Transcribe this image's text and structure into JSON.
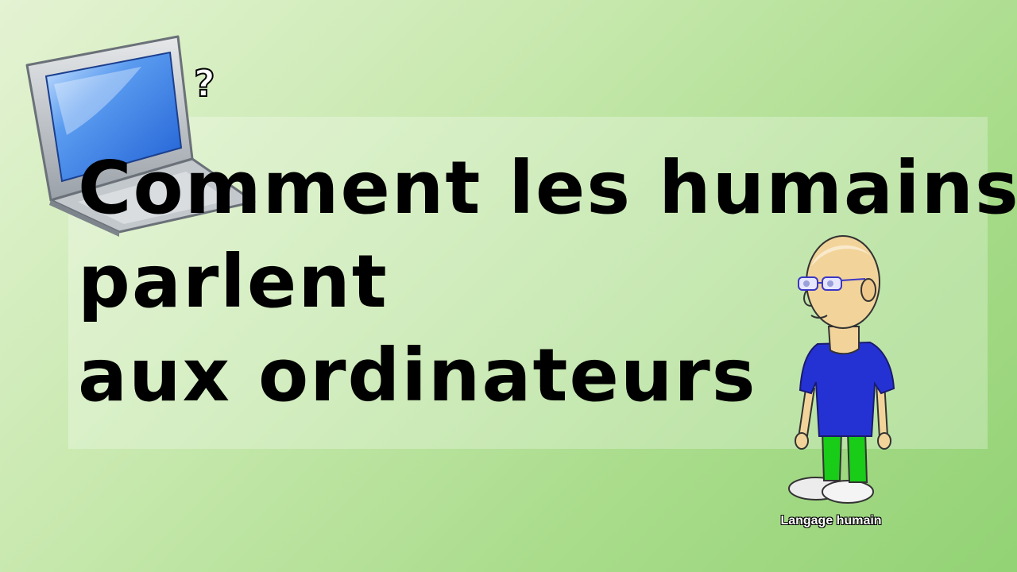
{
  "slide": {
    "title_lines": [
      "Comment les humains",
      "parlent",
      "aux ordinateurs"
    ],
    "question_mark": "?",
    "character_caption": "Langage humain"
  },
  "icons": {
    "laptop": "laptop-icon",
    "character": "bald-man-with-glasses-illustration"
  },
  "colors": {
    "background_light": "#e4f3d3",
    "background_dark": "#93d275",
    "shirt": "#2432d4",
    "pants": "#18cc18",
    "screen": "#2f6fe0"
  }
}
